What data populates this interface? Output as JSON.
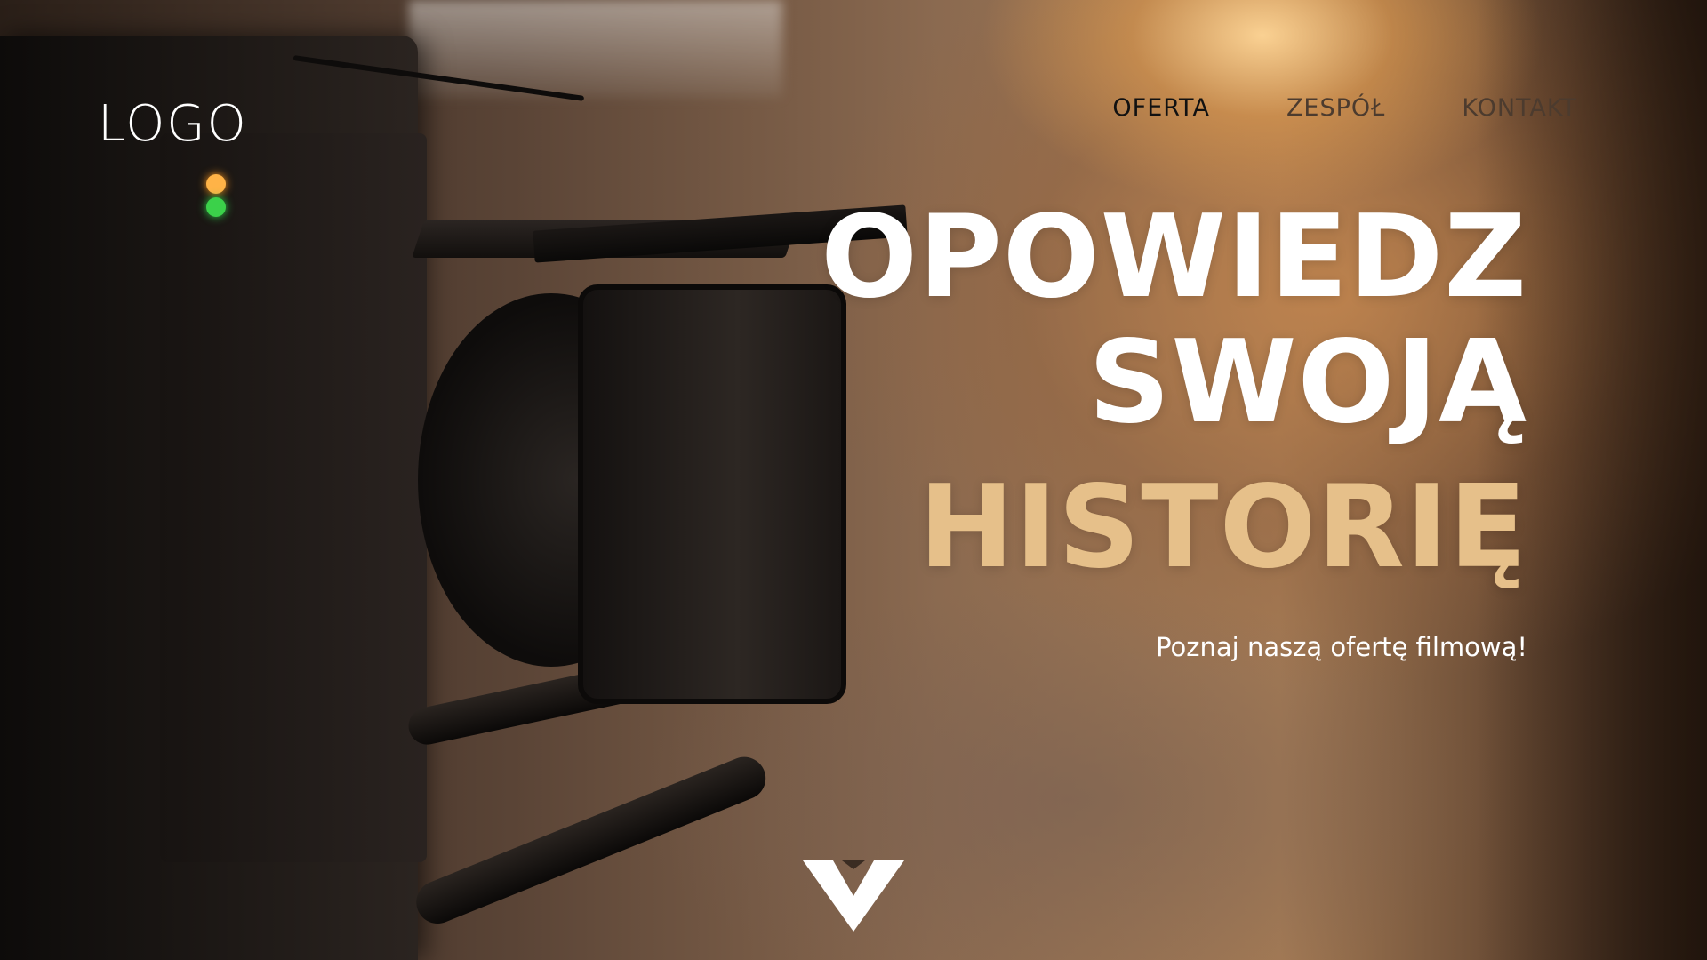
{
  "header": {
    "logo_text": "LOGO",
    "nav": [
      {
        "label": "OFERTA",
        "active": true
      },
      {
        "label": "ZESPÓŁ",
        "active": false
      },
      {
        "label": "KONTAKT",
        "active": false
      }
    ]
  },
  "hero": {
    "lines": [
      "OPOWIEDZ",
      "SWOJĄ",
      "HISTORIĘ"
    ],
    "subtitle": "Poznaj naszą ofertę filmową!"
  },
  "icons": {
    "scroll_down": "chevron-down-icon"
  },
  "colors": {
    "heading_primary": "#ffffff",
    "heading_accent": "#e6c08a",
    "nav_active": "#111111",
    "nav_inactive": "#4c3b2e"
  }
}
